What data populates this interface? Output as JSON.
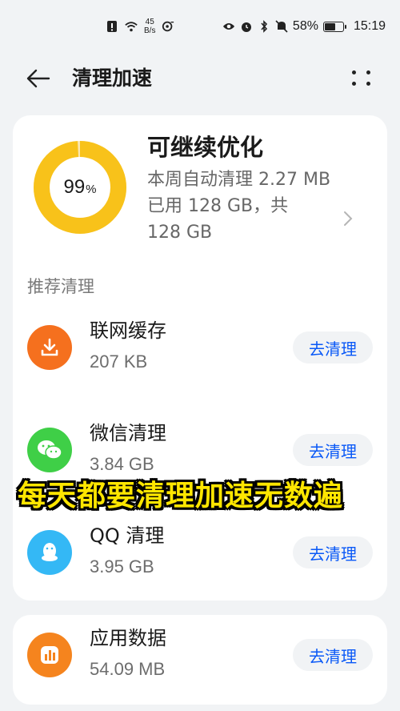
{
  "status_bar": {
    "net_speed_value": "45",
    "net_speed_unit": "B/s",
    "battery": "58%",
    "battery_level": 0.58,
    "time": "15:19"
  },
  "header": {
    "title": "清理加速"
  },
  "summary": {
    "ring_percent": 0.99,
    "ring_value": "99",
    "ring_unit": "%",
    "ring_color": "#f8c21a",
    "status_title": "可继续优化",
    "desc_line1": "本周自动清理 2.27 MB",
    "desc_line2": "已用 128 GB，共",
    "desc_line3": "128 GB"
  },
  "section": {
    "title": "推荐清理"
  },
  "items": [
    {
      "name": "联网缓存",
      "size": "207 KB",
      "action": "去清理",
      "icon": "download-icon",
      "color": "#f5701e"
    },
    {
      "name": "微信清理",
      "size": "3.84 GB",
      "action": "去清理",
      "icon": "wechat-icon",
      "color": "#3fcf47"
    },
    {
      "name": "QQ 清理",
      "size": "3.95 GB",
      "action": "去清理",
      "icon": "qq-icon",
      "color": "#34b8f5"
    },
    {
      "name": "应用数据",
      "size": "54.09 MB",
      "action": "去清理",
      "icon": "app-data-icon",
      "color": "#f5841e"
    }
  ],
  "caption": "每天都要清理加速无数遍"
}
